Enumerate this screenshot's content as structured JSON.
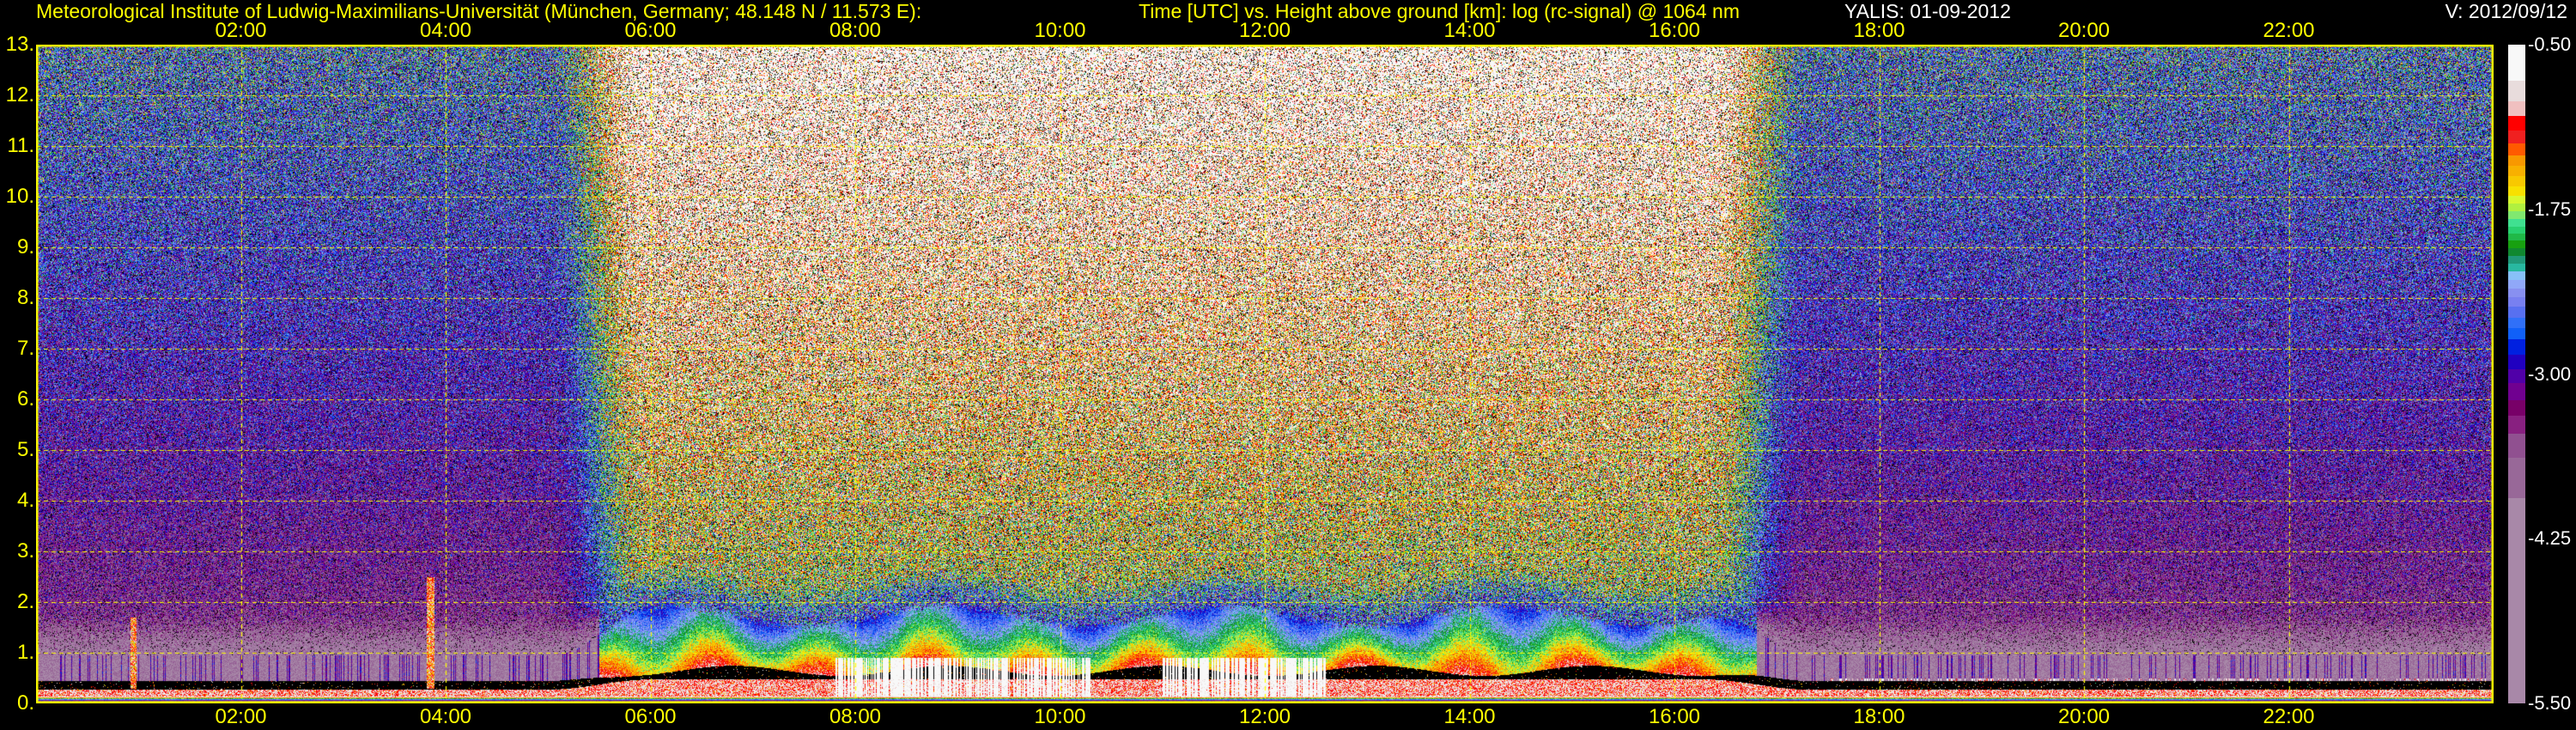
{
  "header": {
    "institute": "Meteorological Institute of Ludwig-Maximilians-Universität (München, Germany; 48.148 N / 11.573 E):",
    "plot_description": "Time [UTC] vs. Height above ground [km]: log (rc-signal) @ 1064 nm",
    "instrument_date": "YALIS: 01-09-2012",
    "version": "V: 2012/09/12"
  },
  "chart_data": {
    "type": "heatmap",
    "title": "Time [UTC] vs. Height above ground [km]: log (rc-signal) @ 1064 nm",
    "xlabel": "Time [UTC]",
    "ylabel": "Height above ground [km]",
    "xlim": [
      0,
      24
    ],
    "ylim": [
      0,
      13
    ],
    "grid": true,
    "x_ticks": [
      "02:00",
      "04:00",
      "06:00",
      "08:00",
      "10:00",
      "12:00",
      "14:00",
      "16:00",
      "18:00",
      "20:00",
      "22:00"
    ],
    "x_tick_values": [
      2,
      4,
      6,
      8,
      10,
      12,
      14,
      16,
      18,
      20,
      22
    ],
    "y_ticks": [
      "0.",
      "1.",
      "2.",
      "3.",
      "4.",
      "5.",
      "6.",
      "7.",
      "8.",
      "9.",
      "10.",
      "11.",
      "12.",
      "13."
    ],
    "y_tick_values": [
      0,
      1,
      2,
      3,
      4,
      5,
      6,
      7,
      8,
      9,
      10,
      11,
      12,
      13
    ],
    "colorbar": {
      "range": [
        -5.5,
        -0.5
      ],
      "labels": [
        "-0.50",
        "-1.75",
        "-3.00",
        "-4.25",
        "-5.50"
      ],
      "label_values": [
        -0.5,
        -1.75,
        -3.0,
        -4.25,
        -5.5
      ],
      "colors_top_to_bottom": [
        "#f8f8f8",
        "#e8dcdc",
        "#f0c0c0",
        "#ff0000",
        "#f02020",
        "#ff5a00",
        "#f89800",
        "#f8b000",
        "#f8c800",
        "#f8e000",
        "#d8f830",
        "#b0f040",
        "#80e870",
        "#40e090",
        "#28d070",
        "#20b848",
        "#18a010",
        "#108830",
        "#209878",
        "#28b8a0",
        "#88c0f8",
        "#90a8f8",
        "#8890f0",
        "#7880f0",
        "#5870f0",
        "#3070f8",
        "#1060f8",
        "#0020e0",
        "#2000c0",
        "#5000a8",
        "#700090",
        "#780068",
        "#882080",
        "#905090",
        "#986898",
        "#a888a8"
      ]
    },
    "features": {
      "daytime_boundary_layer_top_km": 1.7,
      "nighttime_residual_layer_top_km": 0.95,
      "cloud_periods_utc": [
        [
          7.8,
          10.3
        ],
        [
          11.0,
          12.6
        ]
      ]
    }
  },
  "colors": {
    "axis": "#ffff00",
    "text_secondary": "#ffffff",
    "background": "#000000"
  }
}
